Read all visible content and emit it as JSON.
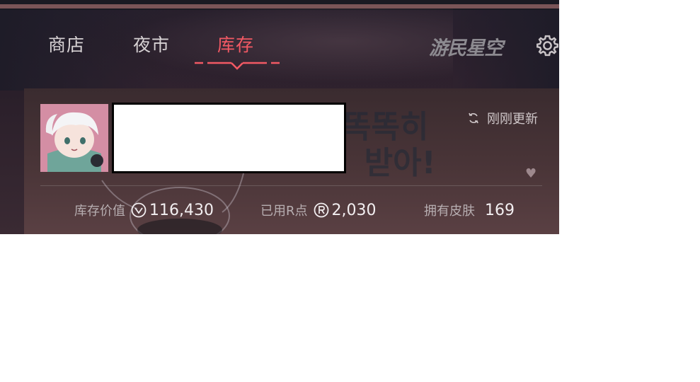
{
  "tabs": [
    {
      "label": "商店",
      "active": false
    },
    {
      "label": "夜市",
      "active": false
    },
    {
      "label": "库存",
      "active": true
    }
  ],
  "brand": {
    "logo_text": "游民星空"
  },
  "header": {
    "settings_icon": "gear-icon"
  },
  "profile": {
    "refresh_label": "刚刚更新",
    "refresh_icon": "refresh-icon"
  },
  "stats": {
    "inventory_value": {
      "label": "库存价值",
      "value": "116,430",
      "icon": "valorant-points-icon"
    },
    "used_r_points": {
      "label": "已用R点",
      "value": "2,030",
      "icon": "radianite-icon"
    },
    "skins_owned": {
      "label": "拥有皮肤",
      "value": "169"
    }
  },
  "colors": {
    "accent": "#f25964",
    "background": "#2a1f2a",
    "text": "#f2eef0"
  }
}
